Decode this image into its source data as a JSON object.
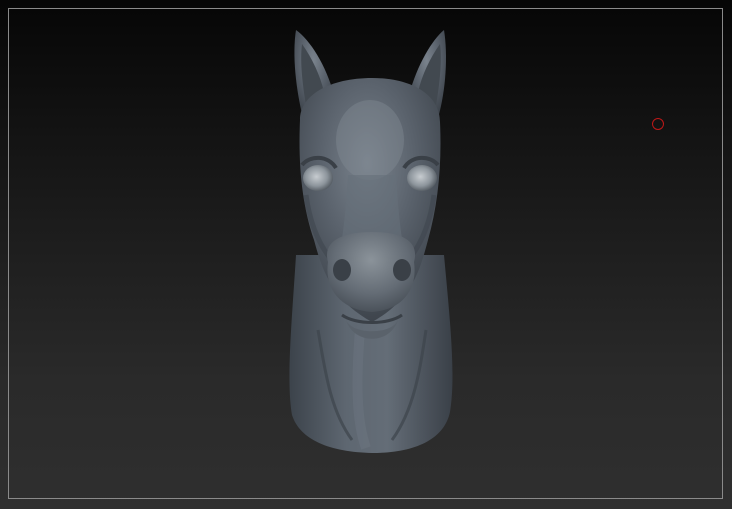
{
  "canvas": {
    "background_top": "#060606",
    "background_bottom": "#2f2f2f",
    "frame_color": "#8a8a8a"
  },
  "model": {
    "icon": "horse-head-sculpt",
    "material_color": "#5d6670"
  },
  "cursor": {
    "icon": "brush-cursor-icon",
    "color": "#c01818"
  }
}
